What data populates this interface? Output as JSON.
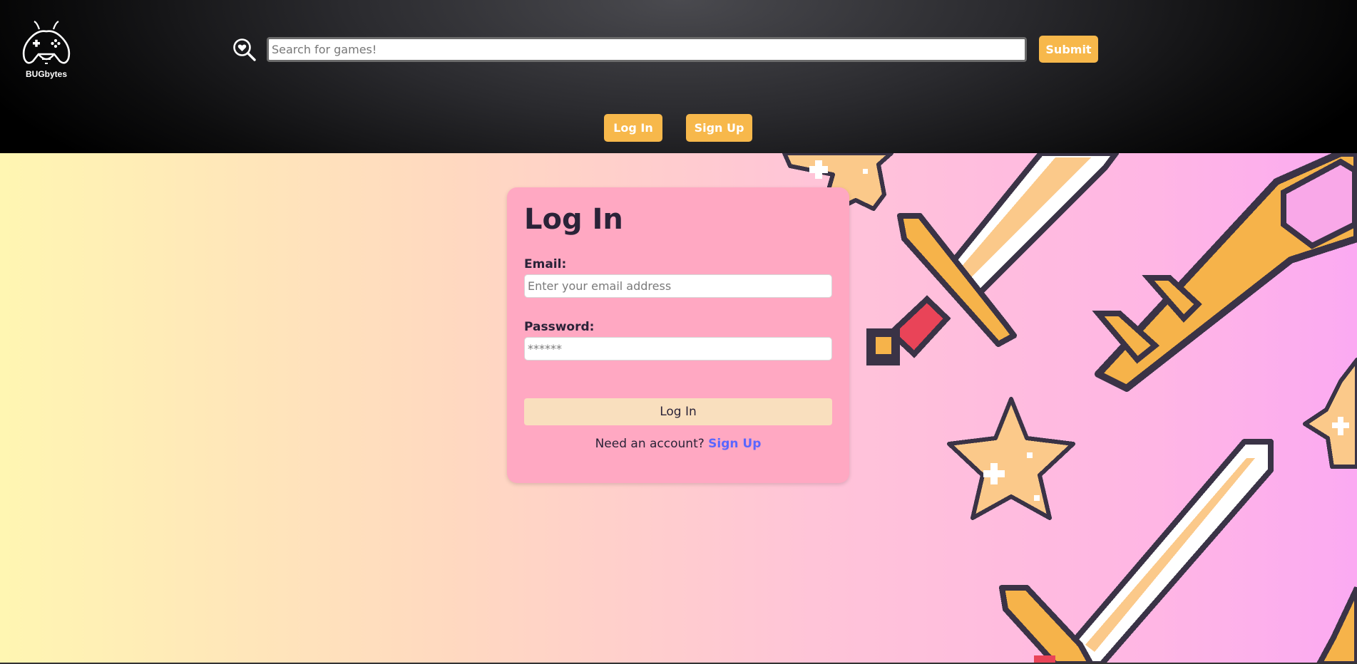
{
  "header": {
    "logo_text": "BUGbytes",
    "search": {
      "placeholder": "Search for games!",
      "value": ""
    },
    "submit_label": "Submit",
    "login_label": "Log In",
    "signup_label": "Sign Up"
  },
  "login_card": {
    "title": "Log In",
    "email_label": "Email:",
    "email_placeholder": "Enter your email address",
    "password_label": "Password:",
    "password_placeholder": "******",
    "login_button": "Log In",
    "signup_prompt": "Need an account?",
    "signup_link": "Sign Up"
  },
  "colors": {
    "accent_orange": "#f7b84b",
    "card_pink": "#ffa8c2",
    "link_blue": "#5a66ff"
  },
  "decorations": [
    "star-icon",
    "sword-icon",
    "key-icon"
  ]
}
